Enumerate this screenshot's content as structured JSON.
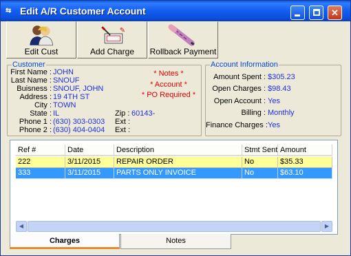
{
  "window": {
    "title": "Edit A/R Customer Account"
  },
  "titlebar_icon": "arrows-icon",
  "toolbar": [
    {
      "label": "Edit Cust",
      "icon": "people-icon"
    },
    {
      "label": "Add Charge",
      "icon": "cash-icon"
    },
    {
      "label": "Rollback Payment",
      "icon": "eraser-icon"
    }
  ],
  "customer": {
    "legend": "Customer",
    "first_name_label": "First Name :",
    "first_name": "JOHN",
    "last_name_label": "Last Name :",
    "last_name": "SNOUF",
    "business_label": "Buisness :",
    "business": "SNOUF, JOHN",
    "address_label": "Address :",
    "address": "19 4TH ST",
    "city_label": "City :",
    "city": "TOWN",
    "state_label": "State :",
    "state": "IL",
    "zip_label": "Zip :",
    "zip": "60143-",
    "phone1_label": "Phone 1 :",
    "phone1": "(630) 303-0303",
    "ext1_label": "Ext :",
    "phone2_label": "Phone 2 :",
    "phone2": "(630) 404-0404",
    "ext2_label": "Ext :",
    "notes_flag": "* Notes *",
    "account_flag": "* Account *",
    "po_flag": "* PO Required *"
  },
  "account": {
    "legend": "Account Information",
    "amount_spent_label": "Amount Spent :",
    "amount_spent": "$305.23",
    "open_charges_label": "Open Charges :",
    "open_charges": "$98.43",
    "open_account_label": "Open Account :",
    "open_account": "Yes",
    "billing_label": "Billing :",
    "billing": "Monthly",
    "finance_label": "Finance Charges :",
    "finance": "Yes"
  },
  "table": {
    "columns": [
      "Ref #",
      "Date",
      "Description",
      "Stmt Sent",
      "Amount"
    ],
    "rows": [
      [
        "222",
        "3/11/2015",
        "REPAIR ORDER",
        "No",
        "$35.33"
      ],
      [
        "333",
        "3/11/2015",
        "PARTS ONLY INVOICE",
        "No",
        "$63.10"
      ]
    ]
  },
  "tabs": [
    "Charges",
    "Notes"
  ],
  "colors": {
    "row_highlight": "#ffff99",
    "row_selected": "#3399ff",
    "titlebar": "#0a57e0",
    "value_blue": "#1f2fe0",
    "flag_red": "#e00000"
  }
}
